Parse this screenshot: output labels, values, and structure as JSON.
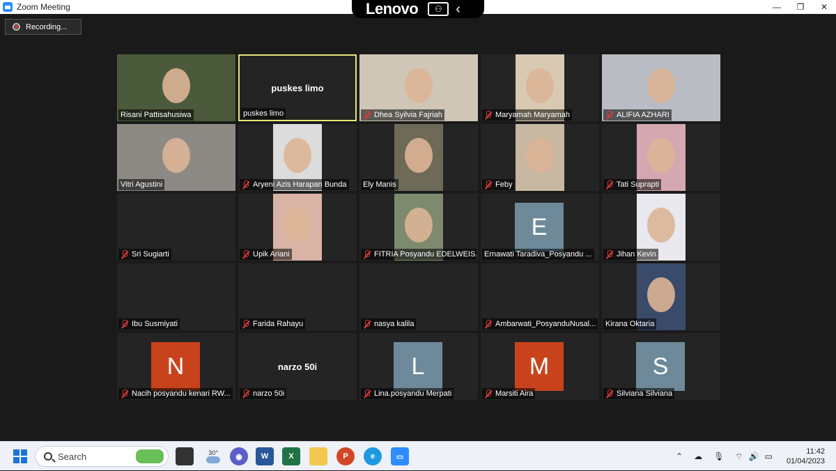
{
  "window": {
    "title": "Zoom Meeting",
    "minimize": "—",
    "maximize": "❐",
    "close": "✕"
  },
  "lenovo": {
    "brand": "Lenovo"
  },
  "recording": {
    "label": "Recording..."
  },
  "participants": [
    {
      "name": "Risani Pattisahusiwa",
      "muted": false,
      "type": "video",
      "bg": "#4a5a3a"
    },
    {
      "name": "puskes limo",
      "muted": false,
      "type": "name",
      "center": "puskes limo",
      "active": true
    },
    {
      "name": "Dhea Syilvia Fajriah",
      "muted": true,
      "type": "video",
      "bg": "#cfc6b8"
    },
    {
      "name": "Maryamah Maryamah",
      "muted": true,
      "type": "video",
      "bg": "#d8c9b2"
    },
    {
      "name": "ALIFIA AZHARI",
      "muted": true,
      "type": "video",
      "bg": "#b9bcc2"
    },
    {
      "name": "Vitri Agustini",
      "muted": false,
      "type": "video",
      "bg": "#8d8a86"
    },
    {
      "name": "Aryeni Azis Harapan Bunda",
      "muted": true,
      "type": "video",
      "bg": "#dcdcdc"
    },
    {
      "name": "Ely Manis",
      "muted": false,
      "type": "video",
      "bg": "#6e6a58"
    },
    {
      "name": "Feby",
      "muted": true,
      "type": "video",
      "bg": "#c8b8a2"
    },
    {
      "name": "Tati Suprapti",
      "muted": true,
      "type": "video",
      "bg": "#d4a8b0"
    },
    {
      "name": "Sri Sugiarti",
      "muted": true,
      "type": "blank"
    },
    {
      "name": "Upik Ariani",
      "muted": true,
      "type": "video",
      "bg": "#d9b3a6"
    },
    {
      "name": "FITRIA Posyandu EDELWEIS...",
      "muted": true,
      "type": "video",
      "bg": "#7d8a6e"
    },
    {
      "name": "Ernawati Taradiva_Posyandu ...",
      "muted": false,
      "type": "letter",
      "letter": "E",
      "color": "#6e8a9a"
    },
    {
      "name": "Jihan Kevin",
      "muted": true,
      "type": "video",
      "bg": "#e8e8ee"
    },
    {
      "name": "Ibu Susmiyati",
      "muted": true,
      "type": "blank"
    },
    {
      "name": "Farida Rahayu",
      "muted": true,
      "type": "blank"
    },
    {
      "name": "nasya kalila",
      "muted": true,
      "type": "blank"
    },
    {
      "name": "Ambarwati_PosyanduNusal...",
      "muted": true,
      "type": "blank"
    },
    {
      "name": "Kirana Oktaria",
      "muted": false,
      "type": "video",
      "bg": "#3a4a6a"
    },
    {
      "name": "Nacih posyandu kenari RW...",
      "muted": true,
      "type": "letter",
      "letter": "N",
      "color": "#c8431c"
    },
    {
      "name": "narzo 50i",
      "muted": true,
      "type": "name",
      "center": "narzo 50i"
    },
    {
      "name": "Lina.posyandu Merpati",
      "muted": true,
      "type": "letter",
      "letter": "L",
      "color": "#6e8a9a"
    },
    {
      "name": "Marsiti Aira",
      "muted": true,
      "type": "letter",
      "letter": "M",
      "color": "#c8431c"
    },
    {
      "name": "Silviana Silviana",
      "muted": true,
      "type": "letter",
      "letter": "S",
      "color": "#6e8a9a"
    }
  ],
  "taskbar": {
    "search_placeholder": "Search",
    "weather_temp": "30°",
    "time": "11:42",
    "date": "01/04/2023"
  }
}
